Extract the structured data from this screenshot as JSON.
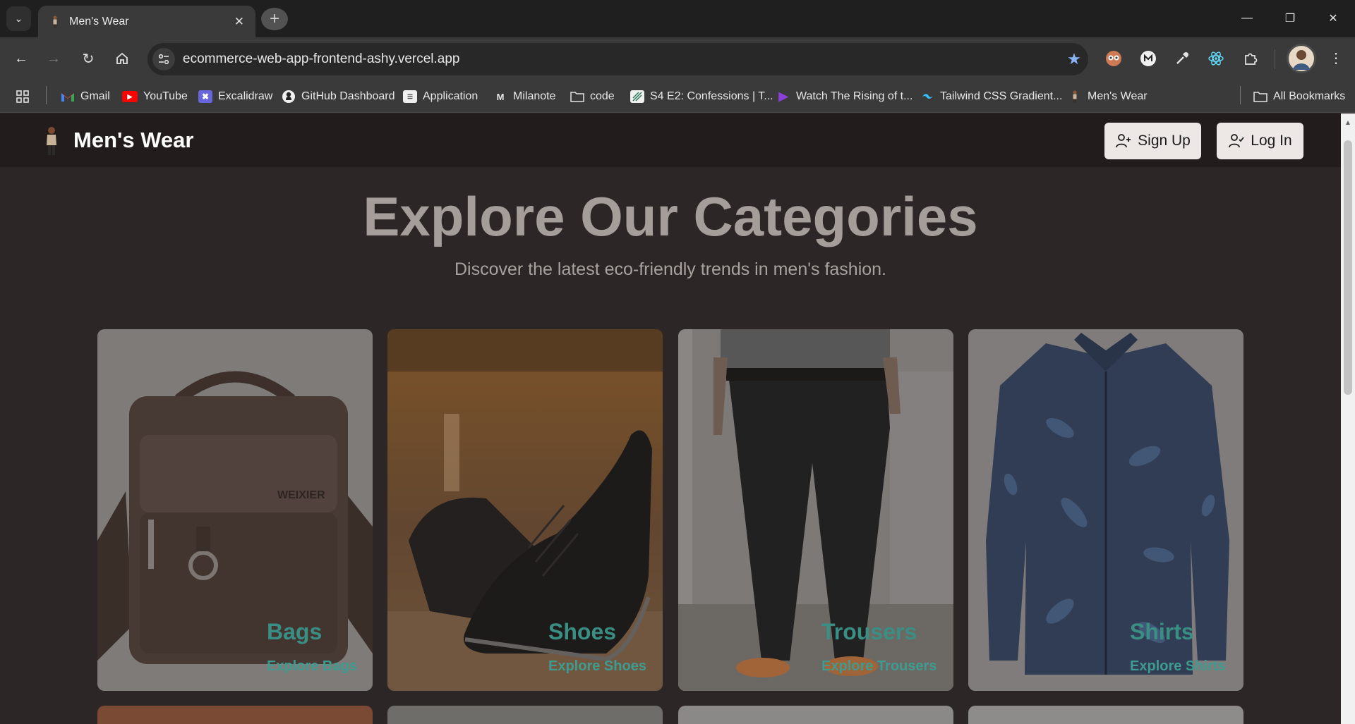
{
  "browser": {
    "tab": {
      "title": "Men's Wear"
    },
    "url": "ecommerce-web-app-frontend-ashy.vercel.app",
    "bookmarks": [
      {
        "label": "Gmail",
        "icon": "gmail-icon"
      },
      {
        "label": "YouTube",
        "icon": "youtube-icon"
      },
      {
        "label": "Excalidraw",
        "icon": "excalidraw-icon"
      },
      {
        "label": "GitHub Dashboard",
        "icon": "github-icon"
      },
      {
        "label": "Application",
        "icon": "application-icon"
      },
      {
        "label": "Milanote",
        "icon": "milanote-icon"
      },
      {
        "label": "code",
        "icon": "folder-icon"
      },
      {
        "label": "S4 E2: Confessions | T...",
        "icon": "bookmark-page-icon"
      },
      {
        "label": "Watch The Rising of t...",
        "icon": "play-icon"
      },
      {
        "label": "Tailwind CSS Gradient...",
        "icon": "tailwind-icon"
      },
      {
        "label": "Men's Wear",
        "icon": "mens-wear-favicon"
      }
    ],
    "all_bookmarks": "All Bookmarks"
  },
  "header": {
    "brand": "Men's Wear",
    "signup_label": "Sign Up",
    "login_label": "Log In"
  },
  "hero": {
    "title": "Explore Our Categories",
    "subtitle": "Discover the latest eco-friendly trends in men's fashion."
  },
  "categories": [
    {
      "name": "Bags",
      "link": "Explore Bags"
    },
    {
      "name": "Shoes",
      "link": "Explore Shoes"
    },
    {
      "name": "Trousers",
      "link": "Explore Trousers"
    },
    {
      "name": "Shirts",
      "link": "Explore Shirts"
    }
  ],
  "colors": {
    "accent_text": "#3a8f85",
    "page_bg": "#2c2726",
    "header_bg": "#221d1c"
  }
}
